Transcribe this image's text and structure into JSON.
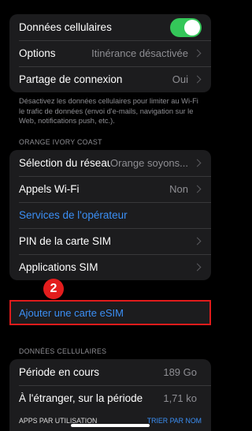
{
  "group1": {
    "cellular_label": "Données cellulaires",
    "cellular_on": true,
    "options_label": "Options",
    "options_value": "Itinérance désactivée",
    "hotspot_label": "Partage de connexion",
    "hotspot_value": "Oui"
  },
  "footnote": "Désactivez les données cellulaires pour limiter au Wi-Fi le trafic de données (envoi d'e-mails, navigation sur le Web, notifications push, etc.).",
  "carrier_header": "ORANGE IVORY COAST",
  "group2": {
    "network_label": "Sélection du réseau",
    "network_value": "Orange soyons...",
    "wifi_calls_label": "Appels Wi-Fi",
    "wifi_calls_value": "Non",
    "carrier_services_label": "Services de l'opérateur",
    "sim_pin_label": "PIN de la carte SIM",
    "sim_apps_label": "Applications SIM"
  },
  "annotation_number": "2",
  "add_esim_label": "Ajouter une carte eSIM",
  "data_header": "DONNÉES CELLULAIRES",
  "group3": {
    "current_period_label": "Période en cours",
    "current_period_value": "189 Go",
    "roaming_label": "À l'étranger, sur la période",
    "roaming_value": "1,71 ko"
  },
  "apps_by_usage_label": "APPS PAR UTILISATION",
  "sort_by_name_label": "TRIER PAR NOM",
  "colors": {
    "toggle_on": "#34c759",
    "link": "#3b8ff5",
    "highlight": "#e01b1b"
  }
}
